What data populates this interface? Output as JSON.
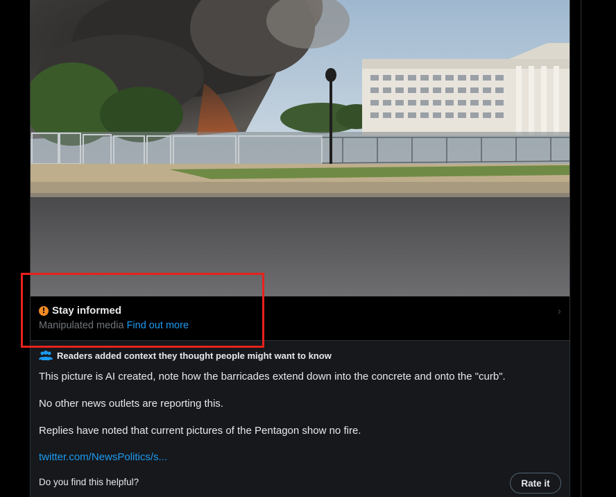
{
  "colors": {
    "background": "#000000",
    "notes_bg": "#16181c",
    "accent_link": "#1d9bf0",
    "warning_icon": "#f18a24",
    "muted_text": "#71767b",
    "highlight_box": "#e8211d"
  },
  "media": {
    "icon": "image"
  },
  "warning": {
    "icon": "exclamation-circle-icon",
    "icon_glyph": "!",
    "title": "Stay informed",
    "subtitle": "Manipulated media",
    "link": "Find out more",
    "chevron": "›"
  },
  "community_notes": {
    "header_icon": "people-icon",
    "header": "Readers added context they thought people might want to know",
    "paragraphs": [
      "This picture is AI created, note how the barricades extend down into the concrete and onto the \"curb\".",
      "No other news outlets are reporting this.",
      "Replies have noted that current pictures of the Pentagon show no fire."
    ],
    "source_link": "twitter.com/NewsPolitics/s...",
    "helpful_question": "Do you find this helpful?",
    "rate_button": "Rate it"
  }
}
